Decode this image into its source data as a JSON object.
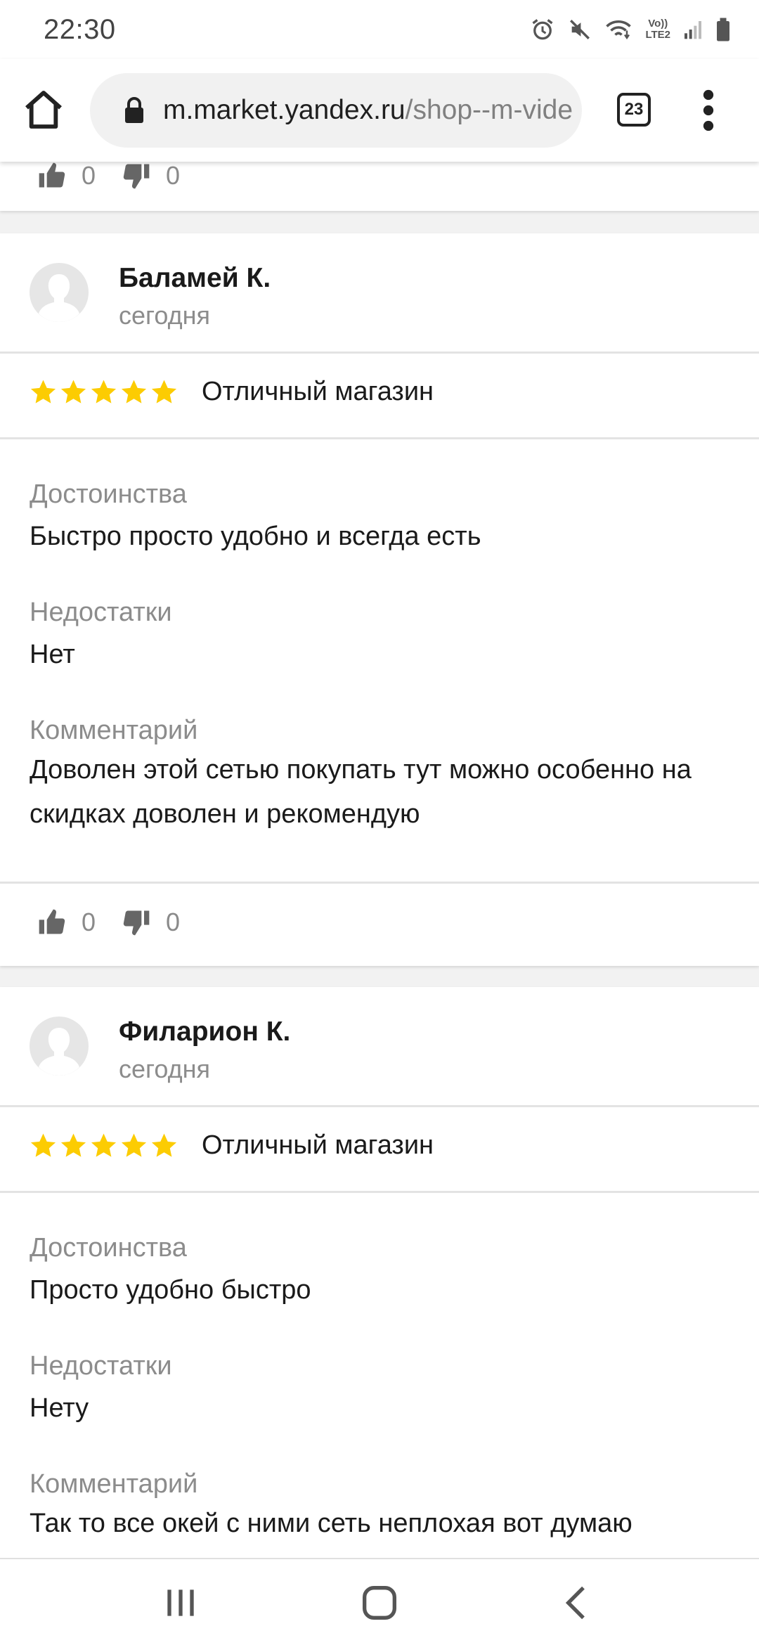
{
  "status_bar": {
    "time": "22:30",
    "icons": [
      "alarm-icon",
      "mute-icon",
      "wifi-icon",
      "volte-lte2-icon",
      "signal-icon",
      "battery-icon"
    ],
    "volte_top": "Vo))",
    "volte_bottom": "LTE2"
  },
  "browser": {
    "url_domain": "m.market.yandex.ru",
    "url_path": "/shop--m-vide",
    "tab_count": "23"
  },
  "colors": {
    "star": "#fccc02",
    "muted_text": "#8c8c8c",
    "divider": "#e3e3e3"
  },
  "previous_review": {
    "likes": "0",
    "dislikes": "0"
  },
  "reviews": [
    {
      "author": "Баламей К.",
      "date": "сегодня",
      "stars": 5,
      "title": "Отличный магазин",
      "pros_label": "Достоинства",
      "pros": "Быстро просто удобно и всегда есть",
      "cons_label": "Недостатки",
      "cons": "Нет",
      "comment_label": "Комментарий",
      "comment": "Доволен этой сетью покупать тут можно особенно на скидках доволен и рекомендую",
      "likes": "0",
      "dislikes": "0"
    },
    {
      "author": "Филарион К.",
      "date": "сегодня",
      "stars": 5,
      "title": "Отличный магазин",
      "pros_label": "Достоинства",
      "pros": "Просто удобно быстро",
      "cons_label": "Недостатки",
      "cons": "Нету",
      "comment_label": "Комментарий",
      "comment": "Так то все окей с ними сеть неплохая вот думаю"
    }
  ],
  "nav": {
    "buttons": [
      "recent-apps-icon",
      "home-icon",
      "back-icon"
    ]
  }
}
